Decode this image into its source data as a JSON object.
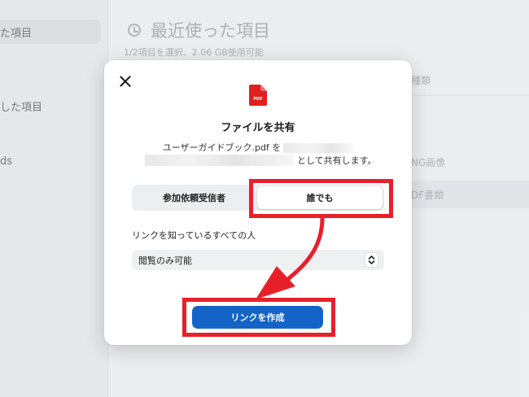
{
  "background": {
    "sidebar_items": [
      "た項目",
      "した項目",
      "ds"
    ],
    "page_title": "最近使った項目",
    "selection_summary": "1/2項目を選択、2.06 GB使用可能",
    "col_header_partial": "種類",
    "row1_kind_partial": "NG画像",
    "row2_kind_partial": "DF書類"
  },
  "dialog": {
    "close_icon": "close-icon",
    "file_icon": "pdf-file-icon",
    "file_icon_label": "PDF",
    "title": "ファイルを共有",
    "line1": "ユーザーガイドブック.pdf を",
    "line2": "として共有します。",
    "segment": {
      "options": [
        "参加依頼受信者",
        "誰でも"
      ],
      "selected": "誰でも"
    },
    "link_section_label": "リンクを知っているすべての人",
    "permission_select": {
      "value": "閲覧のみ可能"
    },
    "create_button_label": "リンクを作成"
  },
  "colors": {
    "accent_blue": "#1464c8",
    "annotation_red": "#e8202a",
    "pdf_red": "#e0201f"
  }
}
